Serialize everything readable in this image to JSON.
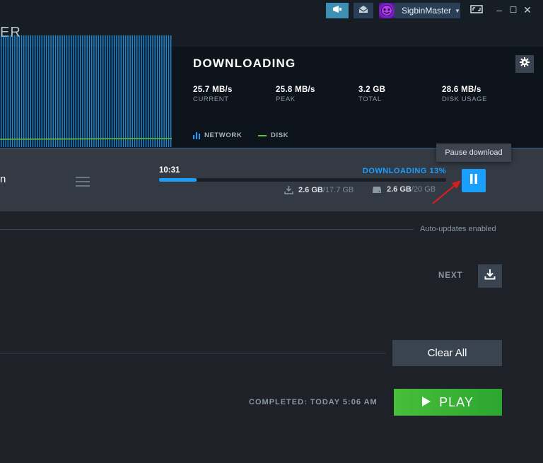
{
  "titlebar": {
    "username": "SigbinMaster",
    "icons": [
      "announcement-icon",
      "mail-icon",
      "avatar",
      "caret-down-icon",
      "big-picture-icon",
      "minimize-icon",
      "maximize-icon",
      "close-icon"
    ],
    "minimize_glyph": "–",
    "maximize_glyph": "☐",
    "close_glyph": "✕",
    "caret_glyph": "▼"
  },
  "header": {
    "title_fragment": "ER"
  },
  "stats": {
    "title": "DOWNLOADING",
    "current": {
      "value": "25.7 MB/s",
      "label": "CURRENT"
    },
    "peak": {
      "value": "25.8 MB/s",
      "label": "PEAK"
    },
    "total": {
      "value": "3.2 GB",
      "label": "TOTAL"
    },
    "disk_usage": {
      "value": "28.6 MB/s",
      "label": "DISK USAGE"
    },
    "legend": {
      "network": "NETWORK",
      "disk": "DISK"
    },
    "colors": {
      "network": "#1a9fff",
      "disk": "#5ec339"
    }
  },
  "active": {
    "game_name_fragment": "n",
    "time_remaining": "10:31",
    "status": "DOWNLOADING 13%",
    "progress": 0.13,
    "download_done": "2.6 GB",
    "download_total": "/17.7 GB",
    "disk_done": "2.6 GB",
    "disk_total": "/20 GB",
    "tooltip": "Pause download"
  },
  "queue": {
    "auto_updates": "Auto-updates enabled",
    "next_label": "NEXT"
  },
  "completed": {
    "clear_all": "Clear All",
    "completed_label": "COMPLETED: TODAY 5:06 AM",
    "play_label": "PLAY"
  },
  "theme": {
    "accent": "#1a9fff",
    "play_green": "#47bf3a",
    "background": "#1e2228"
  }
}
